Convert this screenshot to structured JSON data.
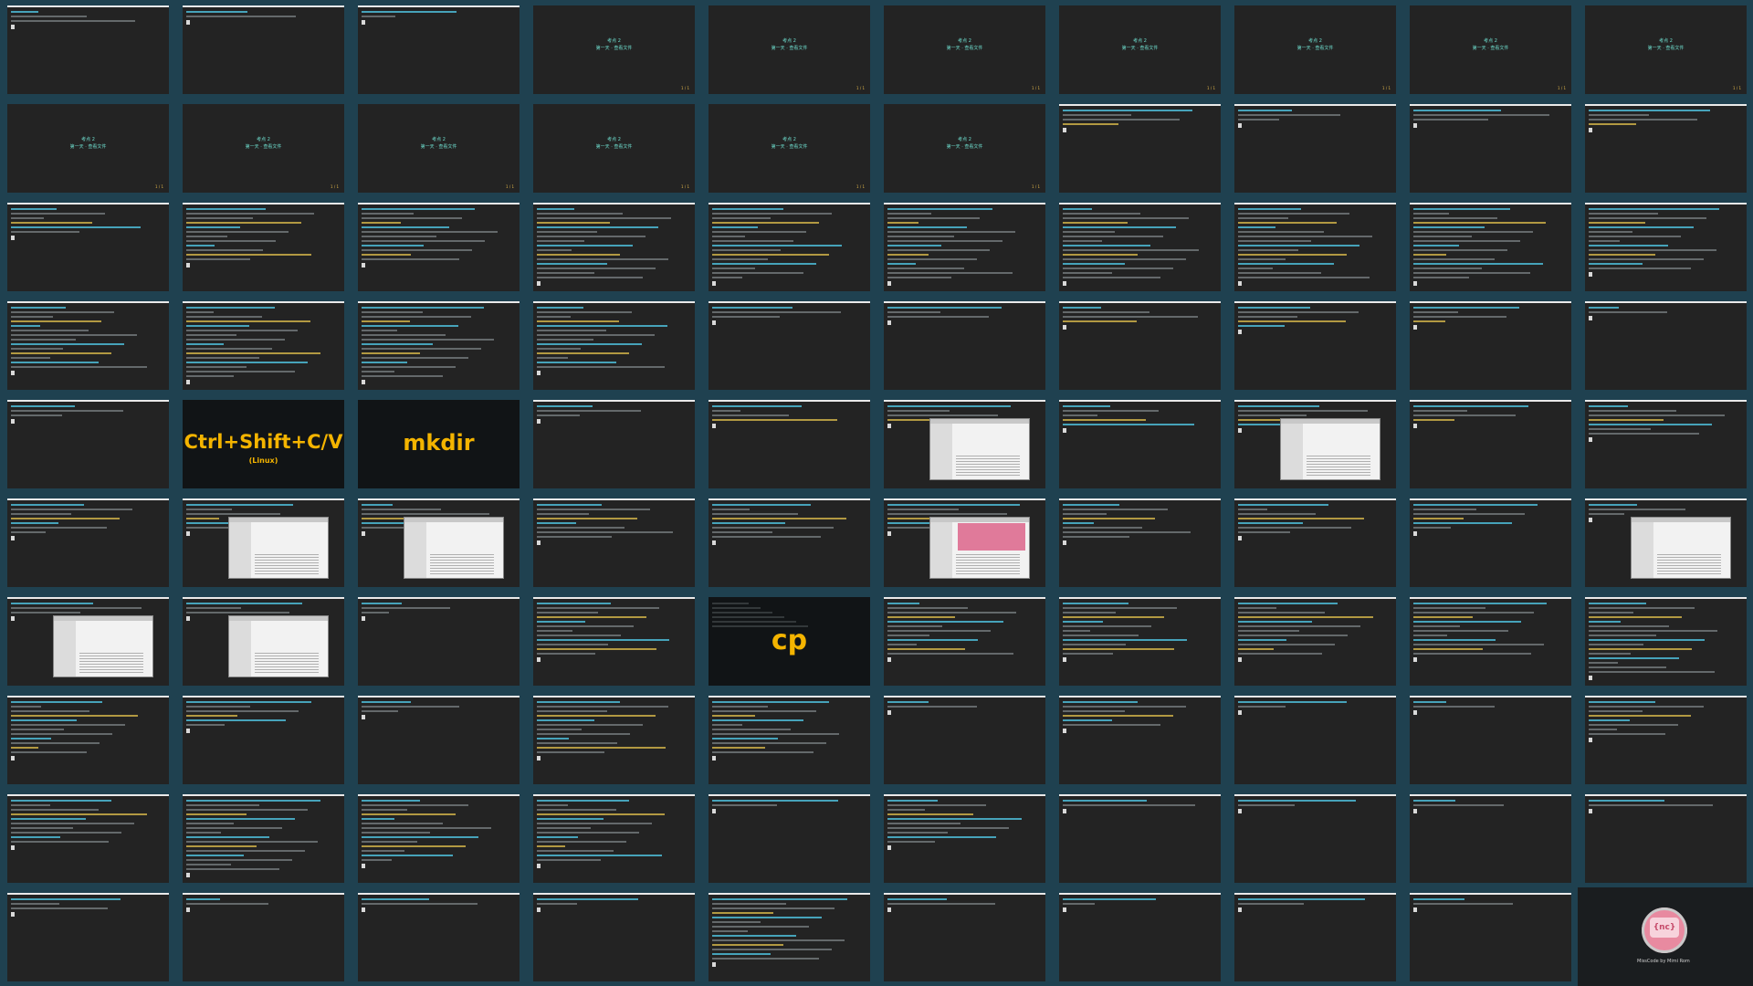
{
  "colors": {
    "background": "#1f4150",
    "terminal": "#232323",
    "highlight_yellow": "#f4b400",
    "slide_text": "#6fe0d0",
    "logo_pink": "#e88aa0"
  },
  "grid": {
    "columns": 10,
    "rows": 10
  },
  "overlays": {
    "shortcut": {
      "label": "Ctrl+Shift+C/V",
      "sub": "(Linux)"
    },
    "mkdir": {
      "label": "mkdir"
    },
    "cp": {
      "label": "cp"
    }
  },
  "slides": {
    "title_line": "考点 2",
    "subtitle_line": "第一天 · 查看文件",
    "pager": "1 / 1"
  },
  "logo": {
    "mark": "{nc}",
    "caption": "MissCode by Mimi Rom"
  },
  "tiles": [
    {
      "kind": "term",
      "lines": 3
    },
    {
      "kind": "term",
      "lines": 2
    },
    {
      "kind": "term",
      "lines": 2
    },
    {
      "kind": "slide"
    },
    {
      "kind": "slide"
    },
    {
      "kind": "slide"
    },
    {
      "kind": "slide"
    },
    {
      "kind": "slide"
    },
    {
      "kind": "slide"
    },
    {
      "kind": "slide"
    },
    {
      "kind": "slide"
    },
    {
      "kind": "slide"
    },
    {
      "kind": "slide"
    },
    {
      "kind": "slide"
    },
    {
      "kind": "slide"
    },
    {
      "kind": "slide"
    },
    {
      "kind": "term",
      "lines": 4
    },
    {
      "kind": "term",
      "lines": 3
    },
    {
      "kind": "term",
      "lines": 3
    },
    {
      "kind": "term",
      "lines": 4
    },
    {
      "kind": "term",
      "lines": 6
    },
    {
      "kind": "term",
      "lines": 12
    },
    {
      "kind": "term",
      "lines": 12
    },
    {
      "kind": "term",
      "lines": 16
    },
    {
      "kind": "term",
      "lines": 16
    },
    {
      "kind": "term",
      "lines": 16
    },
    {
      "kind": "term",
      "lines": 16
    },
    {
      "kind": "term",
      "lines": 16
    },
    {
      "kind": "term",
      "lines": 16
    },
    {
      "kind": "term",
      "lines": 14
    },
    {
      "kind": "term",
      "lines": 14
    },
    {
      "kind": "term",
      "lines": 16
    },
    {
      "kind": "term",
      "lines": 16
    },
    {
      "kind": "term",
      "lines": 14
    },
    {
      "kind": "term",
      "lines": 3
    },
    {
      "kind": "term",
      "lines": 3
    },
    {
      "kind": "term",
      "lines": 4
    },
    {
      "kind": "term",
      "lines": 5
    },
    {
      "kind": "term",
      "lines": 4
    },
    {
      "kind": "term",
      "lines": 2
    },
    {
      "kind": "term",
      "lines": 3
    },
    {
      "kind": "shortcut"
    },
    {
      "kind": "mkdir"
    },
    {
      "kind": "term",
      "lines": 3
    },
    {
      "kind": "term",
      "lines": 4
    },
    {
      "kind": "window",
      "lines": 4
    },
    {
      "kind": "term",
      "lines": 5
    },
    {
      "kind": "window",
      "lines": 5
    },
    {
      "kind": "term",
      "lines": 4
    },
    {
      "kind": "term",
      "lines": 7
    },
    {
      "kind": "term",
      "lines": 7
    },
    {
      "kind": "window",
      "lines": 6
    },
    {
      "kind": "window",
      "lines": 6
    },
    {
      "kind": "term",
      "lines": 8
    },
    {
      "kind": "term",
      "lines": 8
    },
    {
      "kind": "pinkwindow",
      "lines": 6
    },
    {
      "kind": "term",
      "lines": 8
    },
    {
      "kind": "term",
      "lines": 7
    },
    {
      "kind": "term",
      "lines": 6
    },
    {
      "kind": "window",
      "lines": 3
    },
    {
      "kind": "window",
      "lines": 3
    },
    {
      "kind": "window",
      "lines": 3
    },
    {
      "kind": "term",
      "lines": 3
    },
    {
      "kind": "term",
      "lines": 12
    },
    {
      "kind": "cp"
    },
    {
      "kind": "term",
      "lines": 12
    },
    {
      "kind": "term",
      "lines": 12
    },
    {
      "kind": "term",
      "lines": 12
    },
    {
      "kind": "term",
      "lines": 12
    },
    {
      "kind": "term",
      "lines": 16
    },
    {
      "kind": "term",
      "lines": 12
    },
    {
      "kind": "term",
      "lines": 6
    },
    {
      "kind": "term",
      "lines": 3
    },
    {
      "kind": "term",
      "lines": 12
    },
    {
      "kind": "term",
      "lines": 12
    },
    {
      "kind": "term",
      "lines": 2
    },
    {
      "kind": "term",
      "lines": 6
    },
    {
      "kind": "term",
      "lines": 2
    },
    {
      "kind": "term",
      "lines": 2
    },
    {
      "kind": "term",
      "lines": 8
    },
    {
      "kind": "term",
      "lines": 10
    },
    {
      "kind": "term",
      "lines": 16
    },
    {
      "kind": "term",
      "lines": 14
    },
    {
      "kind": "term",
      "lines": 14
    },
    {
      "kind": "term",
      "lines": 2
    },
    {
      "kind": "term",
      "lines": 10
    },
    {
      "kind": "term",
      "lines": 2
    },
    {
      "kind": "term",
      "lines": 2
    },
    {
      "kind": "term",
      "lines": 2
    },
    {
      "kind": "term",
      "lines": 2
    },
    {
      "kind": "term",
      "lines": 3
    },
    {
      "kind": "term",
      "lines": 2
    },
    {
      "kind": "term",
      "lines": 2
    },
    {
      "kind": "term",
      "lines": 2
    },
    {
      "kind": "term",
      "lines": 14
    },
    {
      "kind": "term",
      "lines": 2
    },
    {
      "kind": "term",
      "lines": 2
    },
    {
      "kind": "term",
      "lines": 2
    },
    {
      "kind": "term",
      "lines": 2
    },
    {
      "kind": "logo"
    }
  ]
}
